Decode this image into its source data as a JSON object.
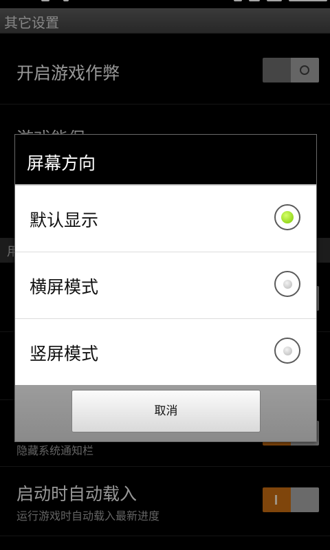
{
  "titlebar": {
    "title": "其它设置"
  },
  "settings": {
    "cheat_title": "开启游戏作弊",
    "save_title": "游戏能保",
    "section_char": "用",
    "hide_status_sub": "隐藏系统通知栏",
    "autoload_title": "启动时自动载入",
    "autoload_sub": "运行游戏时自动载入最新进度"
  },
  "dialog": {
    "title": "屏幕方向",
    "options": [
      {
        "label": "默认显示",
        "selected": true
      },
      {
        "label": "横屏模式",
        "selected": false
      },
      {
        "label": "竖屏模式",
        "selected": false
      }
    ],
    "cancel_label": "取消"
  },
  "colors": {
    "accent_green": "#7cc900",
    "toggle_on": "#c46a12"
  }
}
